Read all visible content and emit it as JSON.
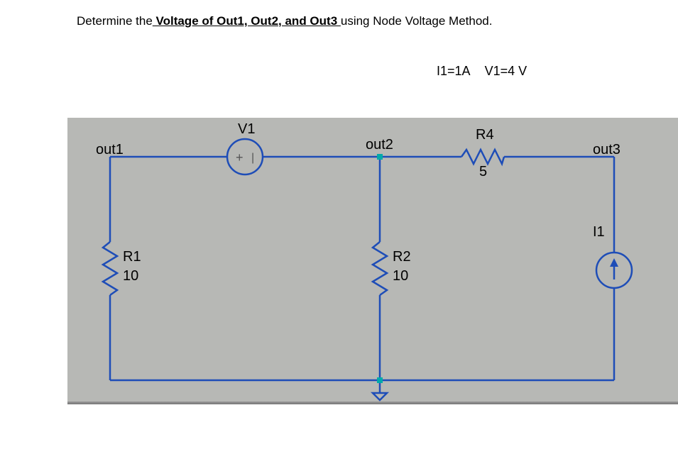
{
  "question": {
    "prefix": "Determine the",
    "underlined": " Voltage of Out1, Out2, and Out3 ",
    "suffix": "using Node Voltage Method."
  },
  "given": {
    "i1": "I1=1A",
    "v1": "V1=4 V"
  },
  "circuit": {
    "nodes": {
      "out1": "out1",
      "out2": "out2",
      "out3": "out3"
    },
    "components": {
      "v1": {
        "name": "V1",
        "polarity_pos": "+",
        "polarity_neg": "|"
      },
      "r1": {
        "name": "R1",
        "value": "10"
      },
      "r2": {
        "name": "R2",
        "value": "10"
      },
      "r4": {
        "name": "R4",
        "value": "5"
      },
      "i1": {
        "name": "I1"
      }
    }
  },
  "chart_data": {
    "type": "table",
    "title": "Circuit parameters for Node Voltage Method",
    "components": [
      {
        "ref": "V1",
        "type": "voltage-source",
        "value": 4,
        "unit": "V",
        "between": [
          "out1",
          "out2"
        ],
        "polarity": "+ on out1 side"
      },
      {
        "ref": "I1",
        "type": "current-source",
        "value": 1,
        "unit": "A",
        "between": [
          "ground",
          "out3"
        ],
        "direction": "into out3"
      },
      {
        "ref": "R1",
        "type": "resistor",
        "value": 10,
        "unit": "ohm",
        "between": [
          "out1",
          "ground"
        ]
      },
      {
        "ref": "R2",
        "type": "resistor",
        "value": 10,
        "unit": "ohm",
        "between": [
          "out2",
          "ground"
        ]
      },
      {
        "ref": "R4",
        "type": "resistor",
        "value": 5,
        "unit": "ohm",
        "between": [
          "out2",
          "out3"
        ]
      }
    ],
    "nodes": [
      "out1",
      "out2",
      "out3",
      "ground"
    ]
  }
}
